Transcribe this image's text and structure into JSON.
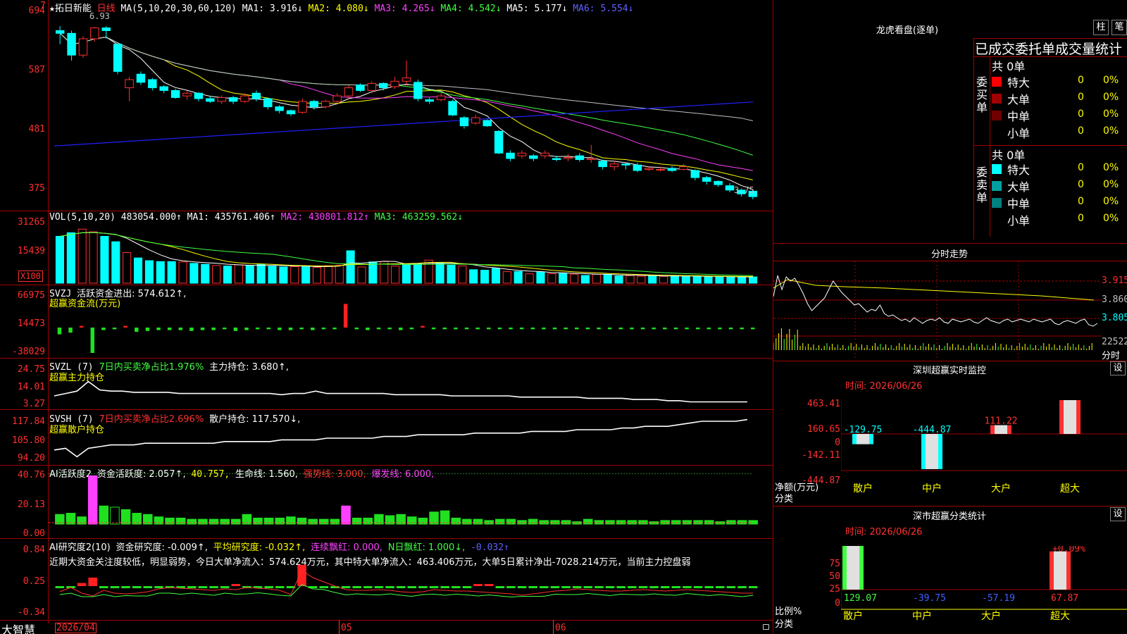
{
  "header": {
    "star": "★",
    "stock_name": "拓日新能",
    "period": "日线",
    "ma_label": "MA(5,10,20,30,60,120)",
    "ma1": "MA1: 3.916↓",
    "ma2": "MA2: 4.080↓",
    "ma3": "MA3: 4.265↓",
    "ma4": "MA4: 4.542↓",
    "ma5": "MA5: 5.177↓",
    "ma6": "MA6: 5.554↓",
    "corner_mark": "7",
    "high_label": "6.93",
    "low_label": "3.75"
  },
  "price_axis": [
    "694",
    "587",
    "481",
    "375"
  ],
  "vol_panel": {
    "label": "VOL(5,10,20)",
    "value": "483054.000↑",
    "ma1": "MA1: 435761.406↑",
    "ma2": "MA2: 430801.812↑",
    "ma3": "MA3: 463259.562↓",
    "axis": [
      "31265",
      "15439"
    ],
    "unit": "X100"
  },
  "svzj_panel": {
    "label": "SVZJ",
    "text": "活跃资金进出: 574.612↑,",
    "subtitle": "超赢资金流(万元)",
    "axis": [
      "66975",
      "14473",
      "-38029"
    ]
  },
  "svzl_panel": {
    "label": "SVZL (7)",
    "text1": "7日内买卖净占比1.976%",
    "text2": "主力持仓: 3.680↑,",
    "subtitle": "超赢主力持仓",
    "axis": [
      "24.75",
      "14.01",
      "3.27"
    ]
  },
  "svsh_panel": {
    "label": "SVSH (7)",
    "text1": "7日内买卖净占比2.696%",
    "text2": "散户持仓: 117.570↓,",
    "subtitle": "超赢散户持仓",
    "axis": [
      "117.84",
      "105.80",
      "94.20"
    ]
  },
  "ai_active_panel": {
    "label": "AI活跃度2",
    "t1": "资金活跃度: 2.057↑,",
    "t2": "40.757,",
    "t3": "生命线: 1.560,",
    "t4": "强势线: 3.000,",
    "t5": "爆发线: 6.000,",
    "axis": [
      "40.76",
      "20.13",
      "0.00"
    ]
  },
  "ai_research_panel": {
    "label": "AI研究度2(10)",
    "t1": "资金研究度: -0.009↑,",
    "t2": "平均研究度: -0.032↑,",
    "t3": "连续飘红: 0.000,",
    "t4": "N日飘红: 1.000↓,",
    "t5": "-0.032↑",
    "note": "近期大资金关注度较低，明显弱势，今日大单净流入：574.624万元，其中特大单净流入：463.406万元，大单5日累计净出-7028.214万元，当前主力控盘弱",
    "axis": [
      "0.84",
      "0.25",
      "-0.34"
    ]
  },
  "time_axis": {
    "brand": "大智慧",
    "labels": [
      "2026/04",
      "05",
      "06"
    ]
  },
  "dragon_tiger": {
    "title": "龙虎看盘(逐单)",
    "btn1": "柱",
    "btn2": "笔",
    "subtitle": "已成交委托单成交量统计",
    "buy_title": "委买单",
    "sell_title": "委卖单",
    "buy_total": "共 0单",
    "sell_total": "共 0单",
    "buy_rows": [
      {
        "name": "特大",
        "count": "0",
        "pct": "0%",
        "color": "#ff0000"
      },
      {
        "name": "大单",
        "count": "0",
        "pct": "0%",
        "color": "#a00000"
      },
      {
        "name": "中单",
        "count": "0",
        "pct": "0%",
        "color": "#700000"
      },
      {
        "name": "小单",
        "count": "0",
        "pct": "0%",
        "color": "#000000"
      }
    ],
    "sell_rows": [
      {
        "name": "特大",
        "count": "0",
        "pct": "0%",
        "color": "#00ffff"
      },
      {
        "name": "大单",
        "count": "0",
        "pct": "0%",
        "color": "#00a0a0"
      },
      {
        "name": "中单",
        "count": "0",
        "pct": "0%",
        "color": "#008080"
      },
      {
        "name": "小单",
        "count": "0",
        "pct": "0%",
        "color": "#000000"
      }
    ]
  },
  "intraday": {
    "title": "分时走势",
    "prices": [
      "3.915",
      "3.860",
      "3.805"
    ],
    "vol_label": "22522",
    "unit": "分时"
  },
  "shenzhen_monitor": {
    "title": "深圳超赢实时监控",
    "btn": "设",
    "date": "时间: 2026/06/26",
    "axis": [
      "463.41",
      "160.65",
      "0",
      "-142.11",
      "-444.87"
    ],
    "ylabel": "净额(万元)",
    "xlabel": "分类",
    "categories": [
      "散户",
      "中户",
      "大户",
      "超大"
    ],
    "values": [
      "-129.75",
      "-444.87",
      "111.22",
      "463.41"
    ]
  },
  "shenzhen_stats": {
    "title": "深市超赢分类统计",
    "btn": "设",
    "date": "时间: 2026/06/26",
    "axis": [
      "75",
      "50",
      "25",
      "0"
    ],
    "ylabel": "比例%",
    "xlabel": "分类",
    "categories": [
      "散户",
      "中户",
      "大户",
      "超大"
    ],
    "values": [
      "129.07",
      "-39.75",
      "-57.19",
      "67.87"
    ],
    "top_label": "+0.09%"
  },
  "chart_data": [
    {
      "type": "candlestick",
      "title": "拓日新能 日线",
      "ylim": [
        3.75,
        6.93
      ],
      "candles": [
        [
          6.85,
          6.8,
          6.93,
          6.6
        ],
        [
          6.8,
          6.4,
          6.85,
          6.3
        ],
        [
          6.4,
          6.7,
          6.75,
          6.35
        ],
        [
          6.7,
          6.9,
          6.92,
          6.65
        ],
        [
          6.9,
          6.85,
          6.93,
          6.7
        ],
        [
          6.6,
          6.1,
          6.62,
          6.05
        ],
        [
          5.8,
          5.95,
          6.0,
          5.55
        ],
        [
          6.05,
          5.9,
          6.1,
          5.85
        ],
        [
          5.95,
          5.8,
          5.98,
          5.75
        ],
        [
          5.82,
          5.75,
          5.85,
          5.7
        ],
        [
          5.75,
          5.62,
          5.78,
          5.6
        ],
        [
          5.65,
          5.7,
          5.75,
          5.58
        ],
        [
          5.7,
          5.6,
          5.72,
          5.55
        ],
        [
          5.6,
          5.55,
          5.65,
          5.52
        ],
        [
          5.55,
          5.62,
          5.66,
          5.5
        ],
        [
          5.62,
          5.55,
          5.65,
          5.5
        ],
        [
          5.55,
          5.65,
          5.7,
          5.52
        ],
        [
          5.7,
          5.6,
          5.75,
          5.55
        ],
        [
          5.6,
          5.45,
          5.62,
          5.4
        ],
        [
          5.45,
          5.38,
          5.48,
          5.33
        ],
        [
          5.38,
          5.32,
          5.4,
          5.28
        ],
        [
          5.35,
          5.55,
          5.6,
          5.32
        ],
        [
          5.55,
          5.45,
          5.58,
          5.4
        ],
        [
          5.45,
          5.55,
          5.58,
          5.42
        ],
        [
          5.55,
          5.65,
          5.7,
          5.5
        ],
        [
          5.65,
          5.8,
          5.85,
          5.6
        ],
        [
          5.85,
          5.75,
          5.88,
          5.72
        ],
        [
          5.75,
          5.88,
          5.92,
          5.7
        ],
        [
          5.88,
          5.8,
          5.9,
          5.75
        ],
        [
          5.82,
          5.92,
          6.0,
          5.78
        ],
        [
          5.92,
          5.98,
          6.3,
          5.85
        ],
        [
          5.9,
          5.6,
          5.95,
          5.55
        ],
        [
          5.58,
          5.55,
          5.62,
          5.5
        ],
        [
          5.58,
          5.65,
          5.7,
          5.55
        ],
        [
          5.55,
          5.3,
          5.58,
          5.28
        ],
        [
          5.25,
          5.1,
          5.28,
          5.05
        ],
        [
          5.15,
          5.25,
          5.3,
          5.12
        ],
        [
          5.2,
          5.1,
          5.22,
          5.08
        ],
        [
          5.0,
          4.6,
          5.02,
          4.58
        ],
        [
          4.6,
          4.5,
          4.65,
          4.45
        ],
        [
          4.55,
          4.6,
          4.65,
          4.5
        ],
        [
          4.55,
          4.5,
          4.58,
          4.45
        ],
        [
          4.55,
          4.6,
          4.65,
          4.5
        ],
        [
          4.5,
          4.48,
          4.55,
          4.45
        ],
        [
          4.5,
          4.52,
          4.58,
          4.45
        ],
        [
          4.55,
          4.48,
          4.6,
          4.44
        ],
        [
          4.48,
          4.5,
          4.75,
          4.42
        ],
        [
          4.45,
          4.35,
          4.48,
          4.3
        ],
        [
          4.35,
          4.4,
          4.45,
          4.28
        ],
        [
          4.4,
          4.38,
          4.42,
          4.3
        ],
        [
          4.38,
          4.28,
          4.42,
          4.25
        ],
        [
          4.3,
          4.32,
          4.36,
          4.27
        ],
        [
          4.3,
          4.3,
          4.35,
          4.26
        ],
        [
          4.32,
          4.28,
          4.36,
          4.25
        ],
        [
          4.3,
          4.35,
          4.4,
          4.28
        ],
        [
          4.28,
          4.15,
          4.3,
          4.1
        ],
        [
          4.15,
          4.08,
          4.18,
          4.02
        ],
        [
          4.08,
          4.02,
          4.1,
          3.98
        ],
        [
          4.0,
          3.92,
          4.05,
          3.88
        ],
        [
          3.92,
          3.85,
          3.95,
          3.8
        ],
        [
          3.9,
          3.8,
          3.92,
          3.75
        ]
      ],
      "series": [
        {
          "name": "MA1",
          "values": "3.916"
        },
        {
          "name": "MA2",
          "values": "4.080"
        },
        {
          "name": "MA3",
          "values": "4.265"
        },
        {
          "name": "MA4",
          "values": "4.542"
        },
        {
          "name": "MA5",
          "values": "5.177"
        },
        {
          "name": "MA6",
          "values": "5.554"
        }
      ]
    },
    {
      "type": "bar",
      "title": "VOL(5,10,20)",
      "ylim": [
        0,
        31265
      ],
      "values": [
        26000,
        28000,
        30000,
        28500,
        26000,
        23000,
        17000,
        14000,
        12500,
        12000,
        12000,
        11800,
        11000,
        10500,
        9800,
        9500,
        10200,
        9700,
        10500,
        9400,
        9000,
        9200,
        9500,
        8800,
        9700,
        10000,
        18000,
        9000,
        11800,
        12000,
        9500,
        10500,
        10800,
        12800,
        11200,
        10000,
        9600,
        7500,
        7200,
        8200,
        6400,
        6500,
        5200,
        6200,
        5300,
        5600,
        5000,
        4300,
        4900,
        4800,
        4000,
        4200,
        3900,
        4100,
        3800,
        4200,
        4000,
        3700,
        3500,
        3600,
        3300,
        3400,
        3500
      ]
    },
    {
      "type": "bar",
      "title": "SVZJ",
      "ylim": [
        -38029,
        66975
      ],
      "values": [
        -8000,
        -6000,
        2000,
        -30000,
        -3000,
        -2000,
        2000,
        -5000,
        -4000,
        -3000,
        -3000,
        -3000,
        -4000,
        -3000,
        -3000,
        -2000,
        -4000,
        -3000,
        -2000,
        -2000,
        -3000,
        -3000,
        -2000,
        -3000,
        -2000,
        -2000,
        28000,
        -2000,
        -3000,
        -2000,
        -2000,
        -3000,
        -2000,
        2000,
        -2000,
        -2000,
        -2000,
        -2000,
        -2000,
        -2000,
        -2000,
        -2000,
        -2000,
        -2000,
        -2000,
        -2000,
        -2000,
        -2000,
        -2000,
        -2000,
        -2000,
        -2000,
        -2000,
        -2000,
        -2000,
        -2000,
        -2000,
        -2000,
        -2000,
        -2000,
        -2000,
        -2000,
        -2000,
        -2000
      ]
    },
    {
      "type": "bar",
      "title": "AI活跃度2",
      "ylim": [
        0,
        40.76
      ],
      "values": [
        8,
        9,
        6,
        40,
        15,
        14,
        12,
        9,
        8,
        6,
        5,
        5,
        4,
        4,
        4,
        4,
        4,
        8,
        5,
        5,
        5,
        6,
        5,
        4,
        4,
        4,
        15,
        5,
        5,
        8,
        7,
        8,
        6,
        5,
        10,
        11,
        5,
        4,
        4,
        3,
        4,
        4,
        3,
        4,
        3,
        3,
        3,
        2,
        4,
        3,
        3,
        3,
        3,
        3,
        2,
        3,
        3,
        3,
        3,
        3,
        2,
        3,
        3,
        3
      ]
    },
    {
      "type": "bar",
      "title": "AI研究度2(10)",
      "ylim": [
        -0.34,
        0.84
      ],
      "values": [
        -0.05,
        -0.05,
        0.08,
        0.22,
        -0.03,
        -0.03,
        -0.02,
        -0.02,
        -0.03,
        -0.05,
        -0.04,
        -0.03,
        -0.04,
        -0.05,
        -0.03,
        -0.02,
        0.02,
        -0.03,
        -0.04,
        -0.05,
        -0.03,
        -0.03,
        0.55,
        -0.02,
        -0.02,
        -0.03,
        -0.02,
        -0.03,
        -0.02,
        -0.02,
        -0.03,
        -0.02,
        -0.02,
        -0.02,
        -0.02,
        -0.02,
        -0.03,
        -0.02,
        0.02,
        0.02,
        -0.03,
        -0.02,
        -0.02,
        -0.03,
        -0.02,
        -0.02,
        -0.02,
        -0.03,
        -0.02,
        -0.03,
        -0.03,
        -0.02,
        -0.03,
        -0.02,
        -0.02,
        -0.02,
        -0.02,
        -0.03,
        -0.03,
        -0.02,
        -0.03,
        -0.03,
        -0.02,
        -0.03
      ]
    }
  ]
}
